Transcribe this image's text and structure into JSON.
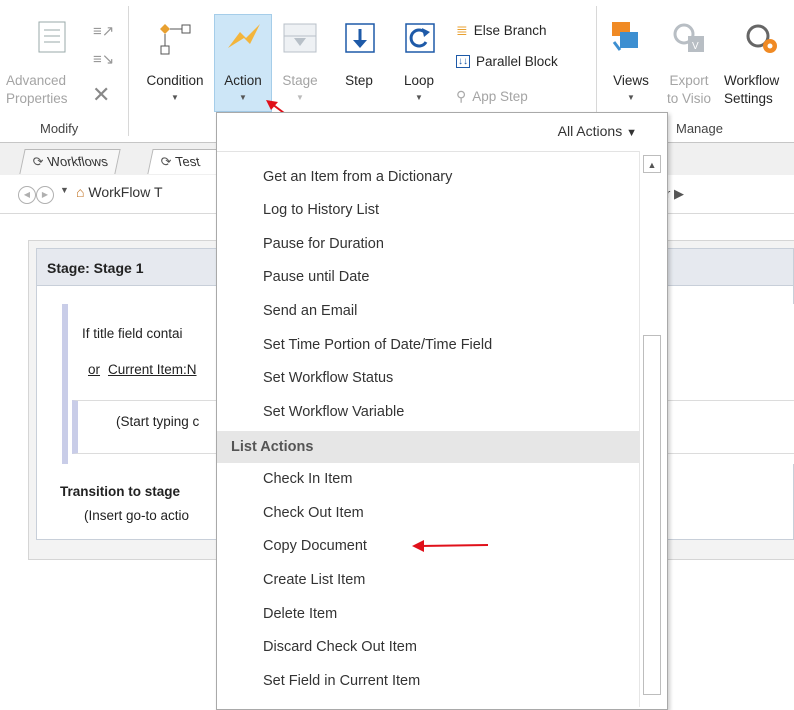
{
  "ribbon": {
    "modify": {
      "advanced_properties": "Advanced Properties",
      "group_label": "Modify"
    },
    "insert": {
      "condition": "Condition",
      "action": "Action",
      "stage": "Stage",
      "step": "Step",
      "loop": "Loop",
      "else_branch": "Else Branch",
      "parallel_block": "Parallel Block",
      "app_step": "App Step"
    },
    "manage": {
      "views": "Views",
      "export_line1": "Export",
      "export_line2": "to Visio",
      "workflow_line1": "Workflow",
      "workflow_line2": "Settings",
      "group_label": "Manage"
    }
  },
  "tabs": [
    {
      "label": "Workflows"
    },
    {
      "label": "Test"
    }
  ],
  "breadcrumb": {
    "item": "WorkFlow T",
    "right": "r ▶"
  },
  "stage": {
    "title": "Stage: Stage 1",
    "condition_text": "If title field contai",
    "or_text": "or",
    "current_item": "Current Item:N",
    "start_typing": "(Start typing c",
    "transition_title": "Transition to stage",
    "insert_goto": "(Insert go-to actio"
  },
  "dropdown": {
    "filter_label": "All Actions",
    "items_top": [
      "Get an Item from a Dictionary",
      "Log to History List",
      "Pause for Duration",
      "Pause until Date",
      "Send an Email",
      "Set Time Portion of Date/Time Field",
      "Set Workflow Status",
      "Set Workflow Variable"
    ],
    "category": "List Actions",
    "items_list": [
      "Check In Item",
      "Check Out Item",
      "Copy Document",
      "Create List Item",
      "Delete Item",
      "Discard Check Out Item",
      "Set Field in Current Item"
    ]
  },
  "colors": {
    "accent_selected": "#cde6f7",
    "arrow_red": "#e0101a"
  }
}
